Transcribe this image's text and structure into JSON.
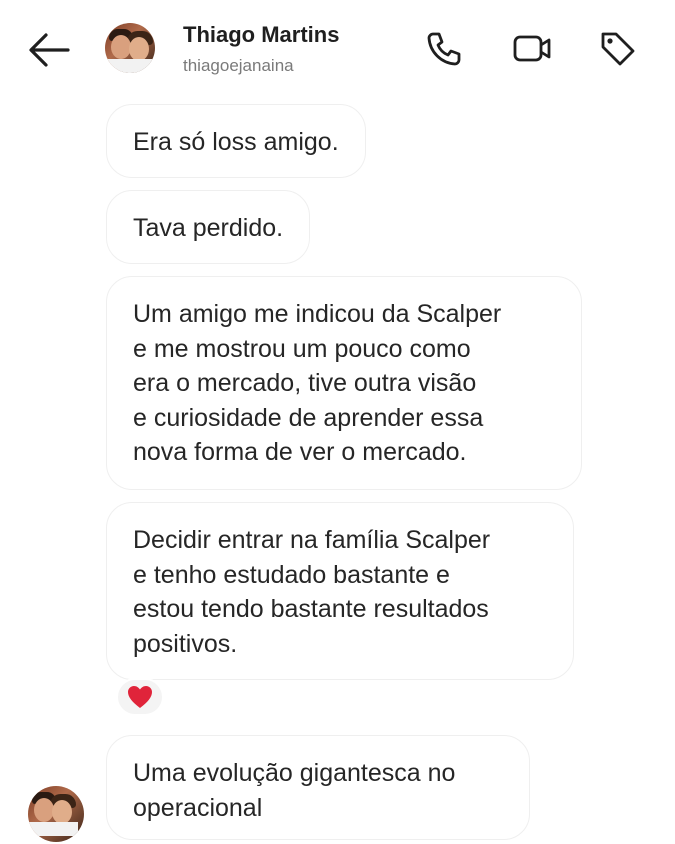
{
  "header": {
    "name": "Thiago Martins",
    "username": "thiagoejanaina",
    "icons": {
      "back": "arrow-left-icon",
      "call": "phone-icon",
      "video": "video-camera-icon",
      "tag": "tag-icon"
    }
  },
  "messages": [
    {
      "text": "Era só loss amigo."
    },
    {
      "text": "Tava perdido."
    },
    {
      "text": "Um amigo me indicou da Scalper\ne me mostrou um pouco como\nera o mercado, tive outra visão\ne curiosidade de aprender essa\nnova forma de ver o mercado."
    },
    {
      "text": "Decidir entrar na família Scalper\ne tenho estudado bastante e\nestou tendo bastante resultados\npositivos."
    },
    {
      "text": "Uma evolução gigantesca no\noperacional"
    }
  ],
  "reaction": {
    "emoji": "heart-icon",
    "color": "#e0243a"
  },
  "colors": {
    "bubble_border": "#efefef",
    "text": "#262626",
    "secondary_text": "#7a7a7a"
  }
}
